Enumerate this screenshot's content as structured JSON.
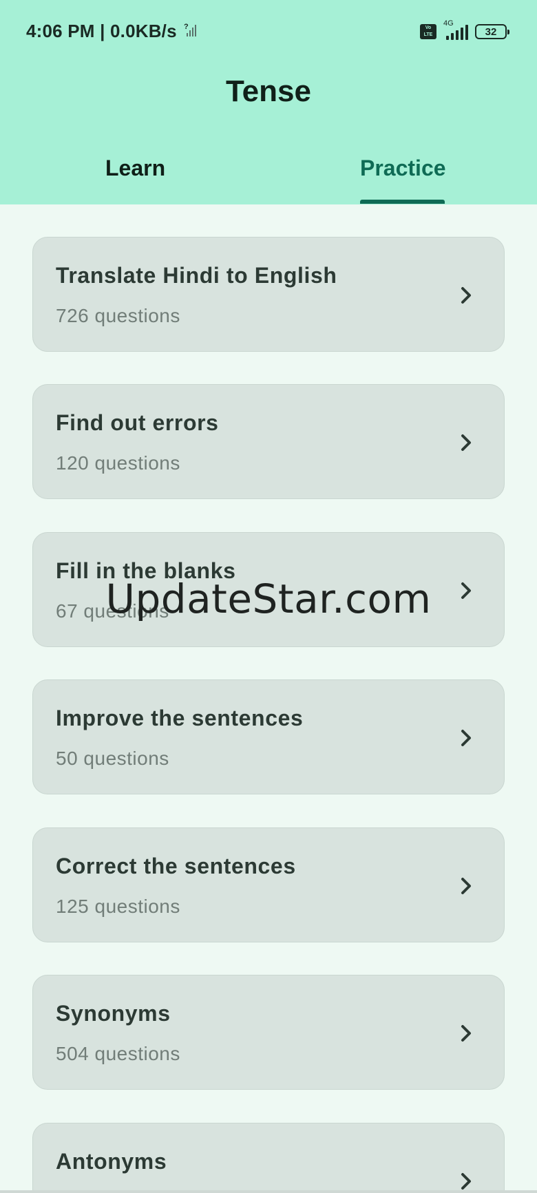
{
  "status": {
    "time_speed": "4:06 PM | 0.0KB/s",
    "network_glyph": "?",
    "volte": "Vo LTE",
    "network_type": "4G",
    "battery_level": "32"
  },
  "header": {
    "title": "Tense",
    "tabs": [
      {
        "label": "Learn",
        "active": false
      },
      {
        "label": "Practice",
        "active": true
      }
    ]
  },
  "practice_items": [
    {
      "title": "Translate Hindi to English",
      "subtitle": "726 questions"
    },
    {
      "title": "Find out errors",
      "subtitle": "120 questions"
    },
    {
      "title": "Fill in the blanks",
      "subtitle": "67 questions"
    },
    {
      "title": "Improve the sentences",
      "subtitle": "50 questions"
    },
    {
      "title": "Correct the sentences",
      "subtitle": "125 questions"
    },
    {
      "title": "Synonyms",
      "subtitle": "504 questions"
    },
    {
      "title": "Antonyms",
      "subtitle": ""
    }
  ],
  "watermark": "UpdateStar.com",
  "colors": {
    "header_bg": "#a6f0d6",
    "accent": "#0f6b55",
    "card_bg": "#d8e3de",
    "page_bg": "#eef9f3"
  }
}
